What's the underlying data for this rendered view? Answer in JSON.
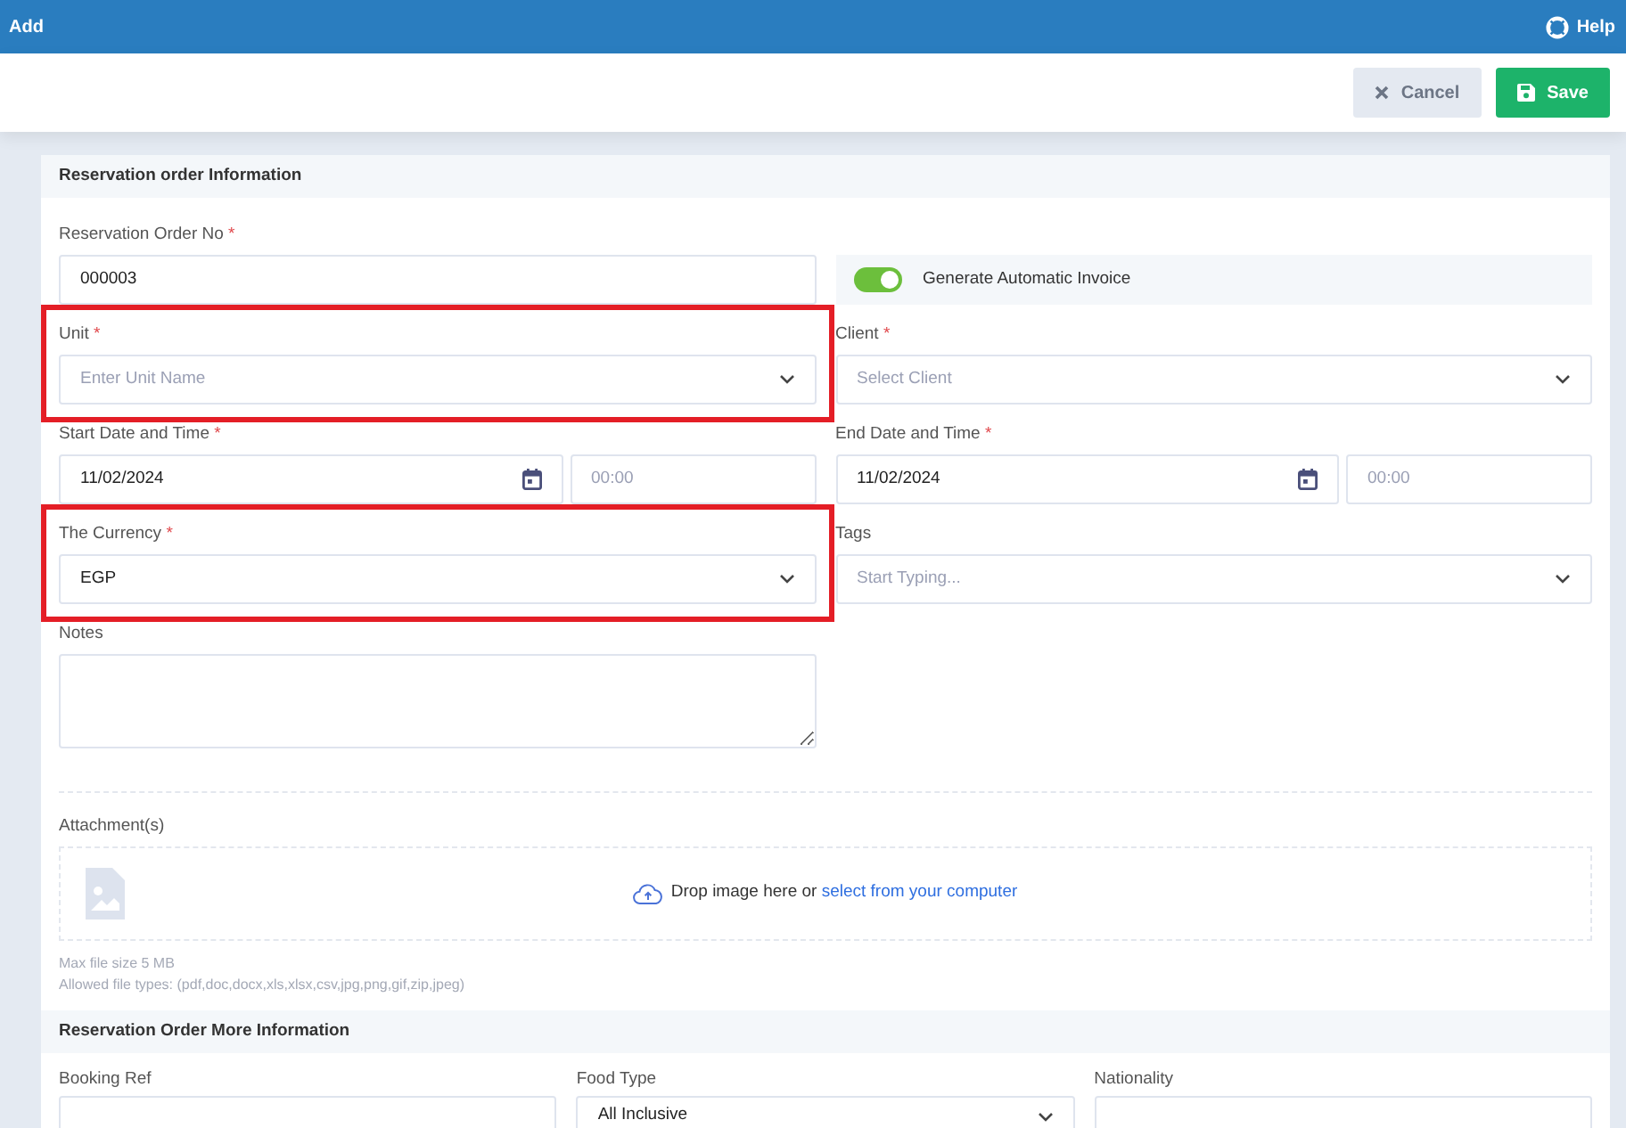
{
  "header": {
    "title": "Add",
    "help": "Help"
  },
  "toolbar": {
    "buttons": [
      {
        "label": "Cancel",
        "kind": "cancel"
      },
      {
        "label": "Save",
        "kind": "save"
      }
    ]
  },
  "sections": [
    {
      "title": "Reservation order Information",
      "fields": [
        {
          "kind": "text",
          "label": "Reservation Order No",
          "mark": "*",
          "value": "000003"
        },
        {
          "kind": "toggle",
          "label": "Generate Automatic Invoice",
          "on": true
        },
        {
          "kind": "select",
          "label": "Unit",
          "mark": "*",
          "placeholder": "Enter Unit Name",
          "highlighted": true
        },
        {
          "kind": "select",
          "label": "Client",
          "mark": "*",
          "placeholder": "Select Client",
          "highlighted": false
        },
        {
          "kind": "datetime",
          "label": "Start Date and Time",
          "mark": "*",
          "date": "11/02/2024",
          "time": {
            "placeholder": "00:00"
          }
        },
        {
          "kind": "datetime",
          "label": "End Date and Time",
          "mark": "*",
          "date": "11/02/2024",
          "time": {
            "placeholder": "00:00"
          }
        },
        {
          "kind": "select",
          "label": "The Currency",
          "mark": "*",
          "value": "EGP",
          "highlighted": true
        },
        {
          "kind": "select",
          "label": "Tags",
          "placeholder": "Start Typing...",
          "highlighted": false
        },
        {
          "kind": "textarea",
          "label": "Notes"
        }
      ],
      "attachment": {
        "label": "Attachment(s)",
        "drop_text": "Drop image here or",
        "link": "select from your computer",
        "notes": [
          "Max file size 5 MB",
          "Allowed file types: (pdf,doc,docx,xls,xlsx,csv,jpg,png,gif,zip,jpeg)"
        ]
      }
    },
    {
      "title": "Reservation Order More Information",
      "fields": [
        {
          "kind": "text",
          "label": "Booking Ref"
        },
        {
          "kind": "select",
          "label": "Food Type",
          "value": "All Inclusive",
          "highlighted": false
        },
        {
          "kind": "text",
          "label": "Nationality"
        }
      ]
    }
  ]
}
